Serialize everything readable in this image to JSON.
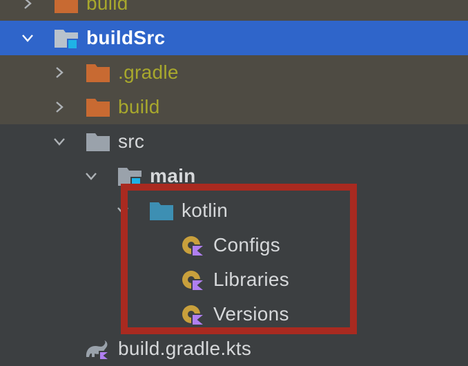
{
  "tree": {
    "rows": [
      {
        "label": "build",
        "icon": "folder-icon"
      },
      {
        "label": "buildSrc",
        "icon": "module-folder-icon"
      },
      {
        "label": ".gradle",
        "icon": "folder-icon"
      },
      {
        "label": "build",
        "icon": "folder-icon"
      },
      {
        "label": "src",
        "icon": "folder-icon"
      },
      {
        "label": "main",
        "icon": "source-root-folder-icon"
      },
      {
        "label": "kotlin",
        "icon": "folder-icon"
      },
      {
        "label": "Configs",
        "icon": "kotlin-object-icon"
      },
      {
        "label": "Libraries",
        "icon": "kotlin-object-icon"
      },
      {
        "label": "Versions",
        "icon": "kotlin-object-icon"
      },
      {
        "label": "build.gradle.kts",
        "icon": "gradle-kotlin-script-icon"
      }
    ]
  },
  "colors": {
    "background": "#3c3f41",
    "excluded_row": "#4e4b43",
    "selected_row": "#2f65ca",
    "excluded_text": "#a8a82d",
    "excluded_folder": "#c86a32",
    "normal_folder": "#9aa2ab",
    "source_folder": "#3d8fb3",
    "highlight_box": "#a92a20"
  }
}
